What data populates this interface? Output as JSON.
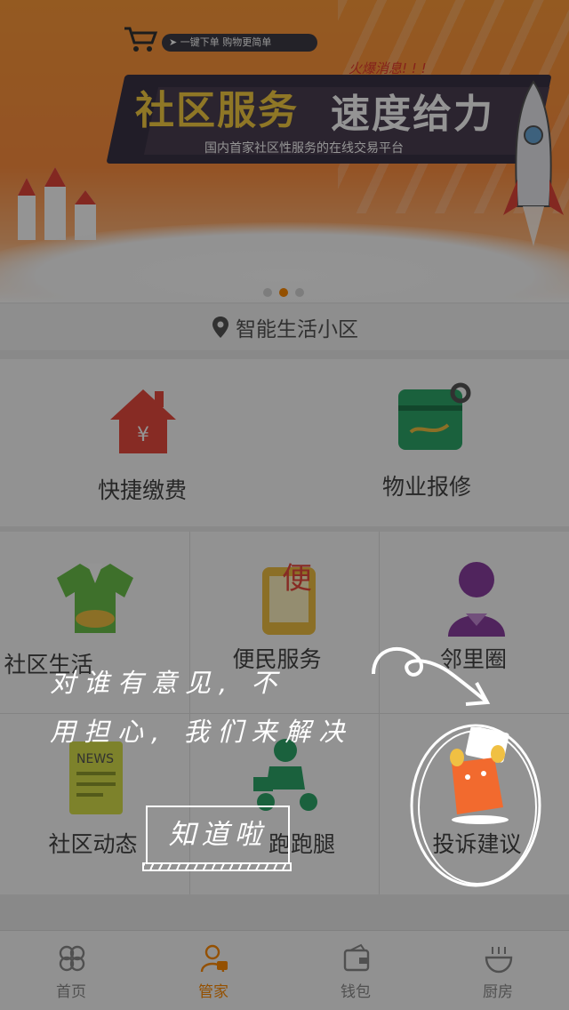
{
  "banner": {
    "slogan_pill": "➤ 一键下单  购物更简单",
    "hot_label": "火爆消息! ! !",
    "title_a": "社区服务",
    "title_b": "速度给力",
    "subtitle": "国内首家社区性服务的在线交易平台"
  },
  "location": {
    "text": "智能生活小区"
  },
  "top_grid": [
    {
      "label": "快捷缴费",
      "icon": "house-payment-icon"
    },
    {
      "label": "物业报修",
      "icon": "repair-card-icon"
    }
  ],
  "main_grid": [
    {
      "label": "社区生活",
      "icon": "shirt-icon"
    },
    {
      "label": "便民服务",
      "icon": "convenience-tablet-icon"
    },
    {
      "label": "邻里圈",
      "icon": "neighbor-person-icon"
    },
    {
      "label": "社区动态",
      "icon": "news-icon"
    },
    {
      "label": "跑跑腿",
      "icon": "delivery-scooter-icon"
    },
    {
      "label": "投诉建议",
      "icon": "complaint-icon"
    }
  ],
  "guide": {
    "line1": "对谁有意见, 不",
    "line2": "用担心, 我们来解决",
    "button": "知道啦"
  },
  "tabbar": [
    {
      "label": "首页",
      "icon": "clover-icon",
      "active": false
    },
    {
      "label": "管家",
      "icon": "butler-icon",
      "active": true
    },
    {
      "label": "钱包",
      "icon": "wallet-icon",
      "active": false
    },
    {
      "label": "厨房",
      "icon": "bowl-icon",
      "active": false
    }
  ],
  "colors": {
    "accent": "#ff8a00",
    "banner_title": "#f6ce43",
    "hot": "#e53b2e"
  }
}
